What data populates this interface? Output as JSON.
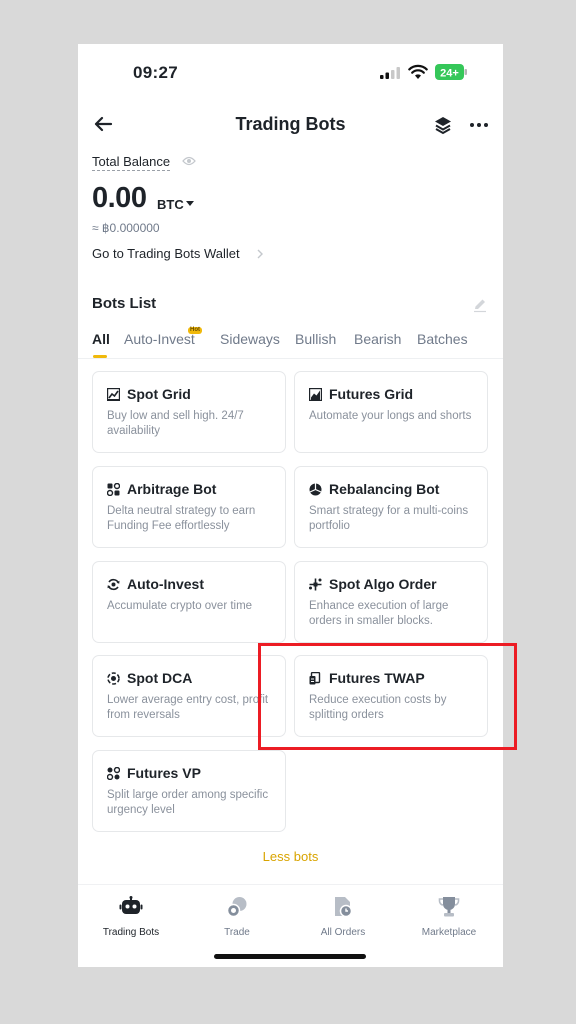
{
  "status_bar": {
    "time": "09:27",
    "battery": "24+"
  },
  "header": {
    "title": "Trading Bots",
    "back_icon": "arrow-left-icon",
    "layers_icon": "layers-icon",
    "more_icon": "more-dots-icon"
  },
  "balance": {
    "label": "Total Balance",
    "value": "0.00",
    "unit": "BTC",
    "fiat": "≈ ฿0.000000",
    "wallet_link": "Go to Trading Bots Wallet"
  },
  "bots_list": {
    "title": "Bots List",
    "tabs": [
      {
        "label": "All",
        "active": true
      },
      {
        "label": "Auto-Invest",
        "badge": "Hot"
      },
      {
        "label": "Sideways"
      },
      {
        "label": "Bullish"
      },
      {
        "label": "Bearish"
      },
      {
        "label": "Batches"
      }
    ],
    "cards": [
      {
        "title": "Spot Grid",
        "desc": "Buy low and sell high. 24/7 availability",
        "icon": "grid-chart-icon"
      },
      {
        "title": "Futures Grid",
        "desc": "Automate your longs and shorts",
        "icon": "futures-chart-icon"
      },
      {
        "title": "Arbitrage Bot",
        "desc": "Delta neutral strategy to earn Funding Fee effortlessly",
        "icon": "arbitrage-icon"
      },
      {
        "title": "Rebalancing Bot",
        "desc": "Smart strategy for a multi-coins portfolio",
        "icon": "pie-icon"
      },
      {
        "title": "Auto-Invest",
        "desc": "Accumulate crypto over time",
        "icon": "auto-invest-icon"
      },
      {
        "title": "Spot Algo Order",
        "desc": "Enhance execution of large orders in smaller blocks.",
        "icon": "algo-icon"
      },
      {
        "title": "Spot DCA",
        "desc": "Lower average entry cost, profit from reversals",
        "icon": "dca-icon"
      },
      {
        "title": "Futures TWAP",
        "desc": "Reduce execution costs by splitting orders",
        "icon": "twap-icon"
      },
      {
        "title": "Futures VP",
        "desc": "Split large order among specific urgency level",
        "icon": "vp-icon"
      }
    ],
    "less_label": "Less bots"
  },
  "bottom_nav": [
    {
      "label": "Trading Bots",
      "icon": "robot-icon",
      "active": true
    },
    {
      "label": "Trade",
      "icon": "trade-icon"
    },
    {
      "label": "All Orders",
      "icon": "orders-icon"
    },
    {
      "label": "Marketplace",
      "icon": "trophy-icon"
    }
  ],
  "colors": {
    "accent": "#F0B90B",
    "highlight_box": "#EC1C24",
    "text": "#1E2329",
    "muted": "#707A8A"
  }
}
